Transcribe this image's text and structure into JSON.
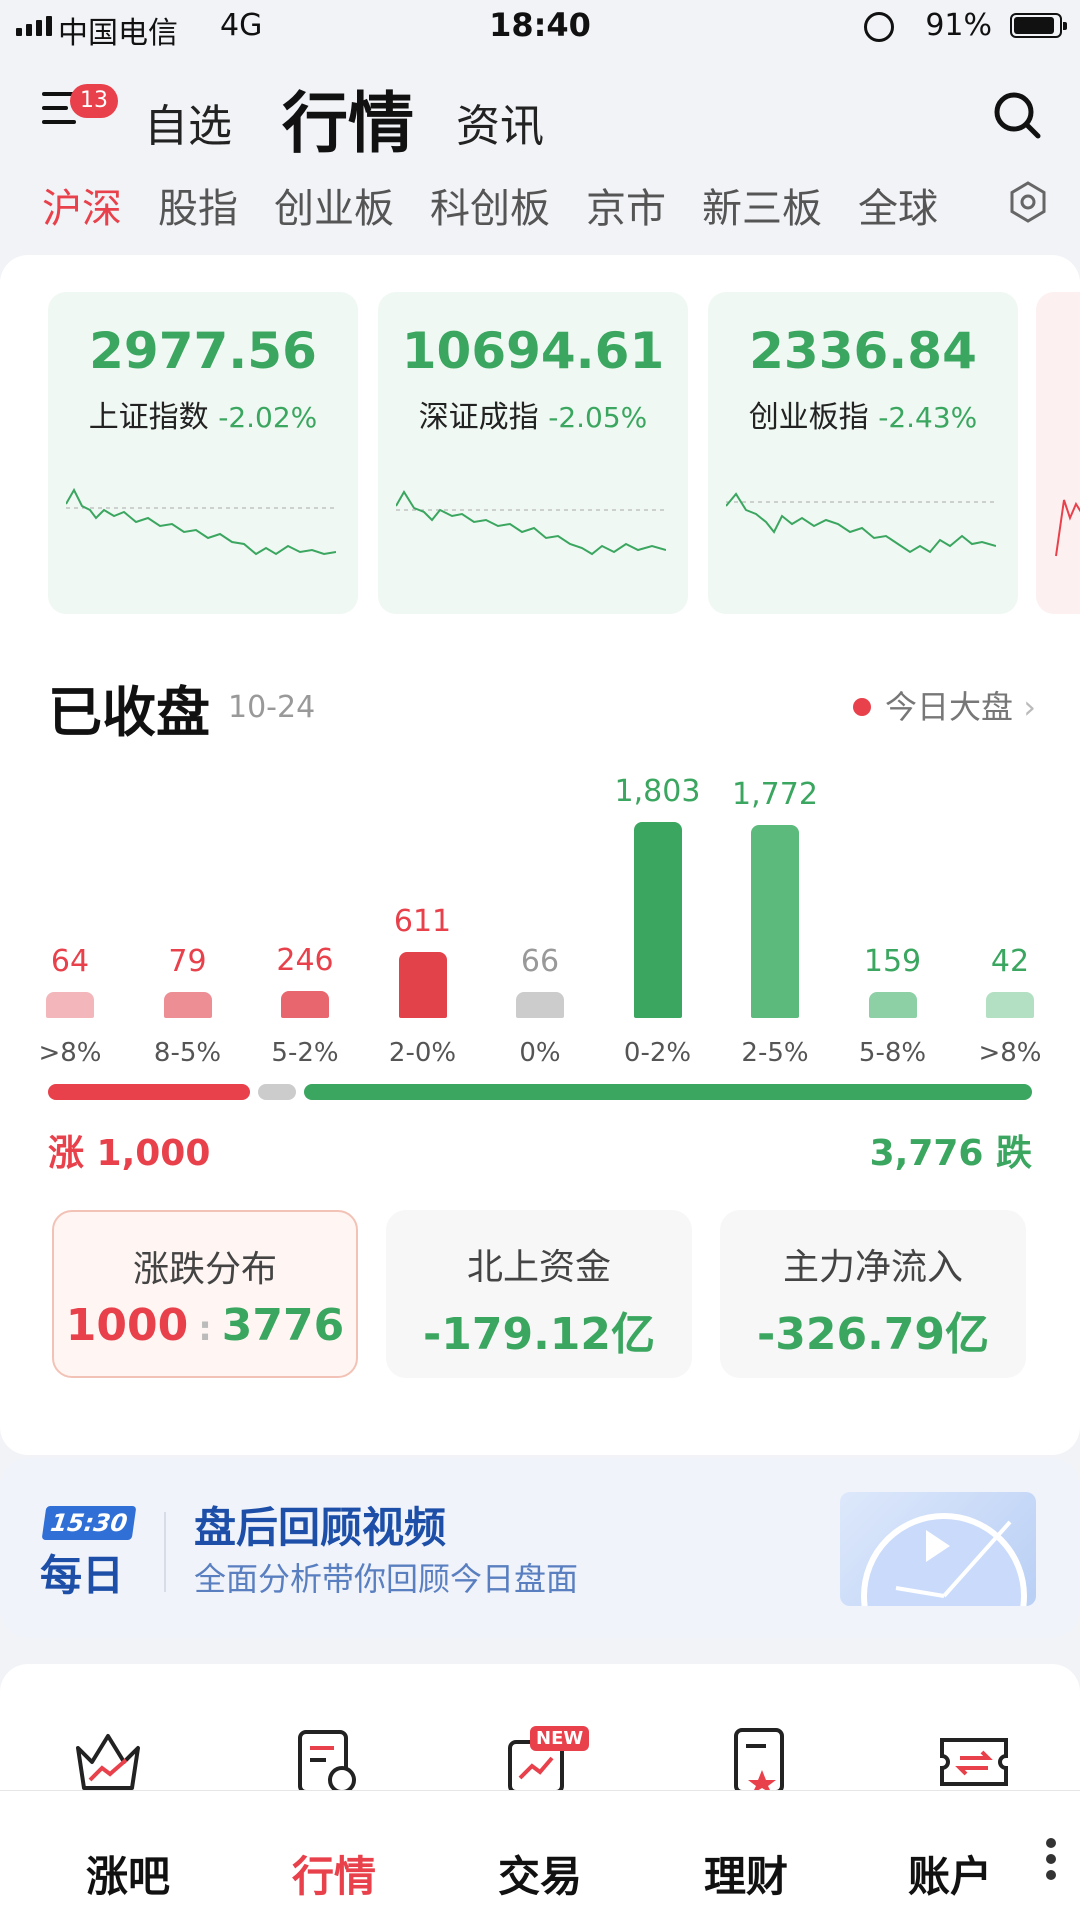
{
  "status": {
    "carrier": "中国电信",
    "network": "4G",
    "time": "18:40",
    "battery": "91%"
  },
  "header": {
    "badge": "13",
    "tabs": [
      {
        "label": "自选"
      },
      {
        "label": "行情"
      },
      {
        "label": "资讯"
      }
    ]
  },
  "subtabs": [
    {
      "label": "沪深"
    },
    {
      "label": "股指"
    },
    {
      "label": "创业板"
    },
    {
      "label": "科创板"
    },
    {
      "label": "京市"
    },
    {
      "label": "新三板"
    },
    {
      "label": "全球"
    }
  ],
  "indices": [
    {
      "value": "2977.56",
      "name": "上证指数",
      "change": "-2.02%"
    },
    {
      "value": "10694.61",
      "name": "深证成指",
      "change": "-2.05%"
    },
    {
      "value": "2336.84",
      "name": "创业板指",
      "change": "-2.43%"
    }
  ],
  "market": {
    "status": "已收盘",
    "date": "10-24",
    "link": "今日大盘"
  },
  "distribution": {
    "categories": [
      ">8%",
      "8-5%",
      "5-2%",
      "2-0%",
      "0%",
      "0-2%",
      "2-5%",
      "5-8%",
      ">8%"
    ],
    "value_labels": [
      "64",
      "79",
      "246",
      "611",
      "66",
      "1,803",
      "1,772",
      "159",
      "42"
    ],
    "values": [
      64,
      79,
      246,
      611,
      66,
      1803,
      1772,
      159,
      42
    ],
    "colors": [
      "#f3b7bb",
      "#ec8e94",
      "#e8666d",
      "#e2424a",
      "#cccccc",
      "#3aa65f",
      "#5cba7c",
      "#8dd0a5",
      "#b3e0c3"
    ]
  },
  "summary": {
    "up": "涨 1,000",
    "down": "3,776 跌"
  },
  "stats": {
    "dist_title": "涨跌分布",
    "dist_up": "1000",
    "dist_sep": ":",
    "dist_down": "3776",
    "north_title": "北上资金",
    "north_value": "-179.12亿",
    "main_title": "主力净流入",
    "main_value": "-326.79亿"
  },
  "video": {
    "badge_time": "15:30",
    "badge_label": "每日",
    "title": "盘后回顾视频",
    "subtitle": "全面分析带你回顾今日盘面"
  },
  "shortcuts": {
    "new_badge": "NEW"
  },
  "tabbar": [
    {
      "label": "涨吧"
    },
    {
      "label": "行情"
    },
    {
      "label": "交易"
    },
    {
      "label": "理财"
    },
    {
      "label": "账户"
    }
  ],
  "colors": {
    "up": "#e8414b",
    "down": "#3aa65f",
    "link": "#1d4fa8"
  }
}
